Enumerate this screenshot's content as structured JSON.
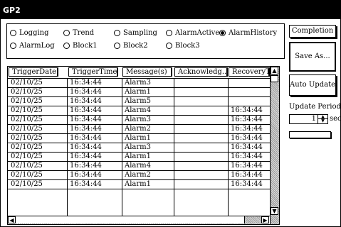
{
  "window": {
    "title": "GP2"
  },
  "modes": [
    {
      "label": "Logging",
      "selected": false
    },
    {
      "label": "Trend",
      "selected": false
    },
    {
      "label": "Sampling",
      "selected": false
    },
    {
      "label": "AlarmActive",
      "selected": false
    },
    {
      "label": "AlarmHistory",
      "selected": true
    },
    {
      "label": "AlarmLog",
      "selected": false
    },
    {
      "label": "Block1",
      "selected": false
    },
    {
      "label": "Block2",
      "selected": false
    },
    {
      "label": "Block3",
      "selected": false
    }
  ],
  "table": {
    "columns": [
      "TriggerDate",
      "TriggerTime",
      "Message(s)",
      "Acknowledg...",
      "RecoveryTm"
    ],
    "rows": [
      [
        "02/10/25",
        "16:34:44",
        "Alarm3",
        "",
        ""
      ],
      [
        "02/10/25",
        "16:34:44",
        "Alarm1",
        "",
        ""
      ],
      [
        "02/10/25",
        "16:34:44",
        "Alarm5",
        "",
        ""
      ],
      [
        "02/10/25",
        "16:34:44",
        "Alarm4",
        "",
        "16:34:44"
      ],
      [
        "02/10/25",
        "16:34:44",
        "Alarm3",
        "",
        "16:34:44"
      ],
      [
        "02/10/25",
        "16:34:44",
        "Alarm2",
        "",
        "16:34:44"
      ],
      [
        "02/10/25",
        "16:34:44",
        "Alarm1",
        "",
        "16:34:44"
      ],
      [
        "02/10/25",
        "16:34:44",
        "Alarm3",
        "",
        "16:34:44"
      ],
      [
        "02/10/25",
        "16:34:44",
        "Alarm1",
        "",
        "16:34:44"
      ],
      [
        "02/10/25",
        "16:34:44",
        "Alarm4",
        "",
        "16:34:44"
      ],
      [
        "02/10/25",
        "16:34:44",
        "Alarm2",
        "",
        "16:34:44"
      ],
      [
        "02/10/25",
        "16:34:44",
        "Alarm1",
        "",
        "16:34:44"
      ]
    ]
  },
  "buttons": {
    "completion": "Completion",
    "save_as": "Save As...",
    "auto_update": "Auto Update"
  },
  "update_period": {
    "label": "Update Period",
    "value": "1",
    "unit": "sec"
  },
  "icons": {
    "up": "scroll-up-arrow-icon",
    "down": "scroll-down-arrow-icon",
    "left": "scroll-left-arrow-icon",
    "right": "scroll-right-arrow-icon"
  }
}
